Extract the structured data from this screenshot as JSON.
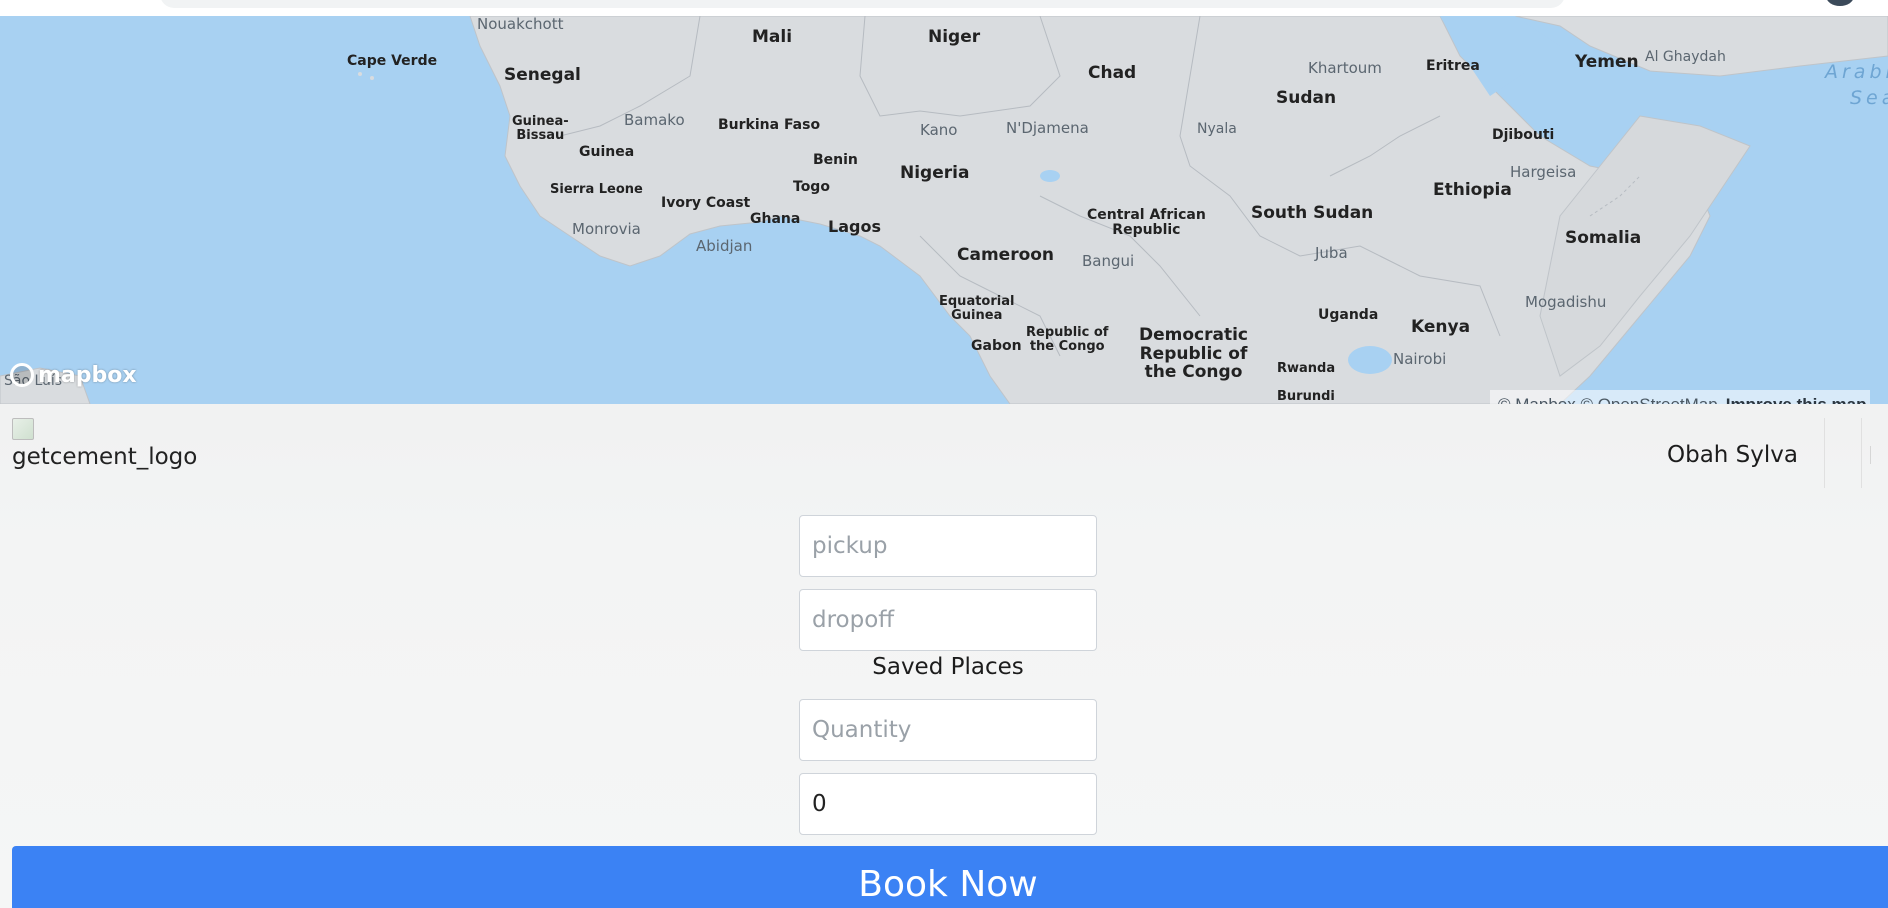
{
  "map": {
    "labels": {
      "nouakchott": "Nouakchott",
      "mali": "Mali",
      "niger": "Niger",
      "chad": "Chad",
      "khartoum": "Khartoum",
      "eritrea": "Eritrea",
      "yemen": "Yemen",
      "al_ghaydah": "Al Ghaydah",
      "arabian_sea_1": "Arabi",
      "arabian_sea_2": "Sea",
      "cape_verde": "Cape Verde",
      "senegal": "Senegal",
      "sudan": "Sudan",
      "guinea_bissau": "Guinea-\nBissau",
      "bamako": "Bamako",
      "burkina_faso": "Burkina Faso",
      "kano": "Kano",
      "ndjamena": "N'Djamena",
      "nyala": "Nyala",
      "djibouti": "Djibouti",
      "guinea": "Guinea",
      "benin": "Benin",
      "nigeria": "Nigeria",
      "hargeisa": "Hargeisa",
      "sierra_leone": "Sierra Leone",
      "togo": "Togo",
      "ethiopia": "Ethiopia",
      "ivory_coast": "Ivory Coast",
      "ghana": "Ghana",
      "central_african_republic": "Central African\nRepublic",
      "south_sudan": "South Sudan",
      "monrovia": "Monrovia",
      "lagos": "Lagos",
      "somalia": "Somalia",
      "abidjan": "Abidjan",
      "cameroon": "Cameroon",
      "bangui": "Bangui",
      "juba": "Juba",
      "equatorial_guinea": "Equatorial\nGuinea",
      "mogadishu": "Mogadishu",
      "republic_of_the_congo": "Republic of\nthe Congo",
      "democratic_republic_of_the_congo": "Democratic\nRepublic of\nthe Congo",
      "uganda": "Uganda",
      "kenya": "Kenya",
      "gabon": "Gabon",
      "nairobi": "Nairobi",
      "rwanda": "Rwanda",
      "burundi": "Burundi",
      "sao_luis": "São Luís"
    },
    "logo_text": "mapbox",
    "attribution": "© Mapbox © OpenStreetMap",
    "improve_link": "Improve this map"
  },
  "header": {
    "logo_alt": "getcement_logo",
    "user_name": "Obah Sylva"
  },
  "form": {
    "pickup_placeholder": "pickup",
    "dropoff_placeholder": "dropoff",
    "saved_places_label": "Saved Places",
    "quantity_placeholder": "Quantity",
    "amount_value": "0",
    "book_button_label": "Book Now"
  },
  "colors": {
    "water": "#a8d1f2",
    "land": "#d9dcdf",
    "accent_button": "#3b82f4"
  }
}
